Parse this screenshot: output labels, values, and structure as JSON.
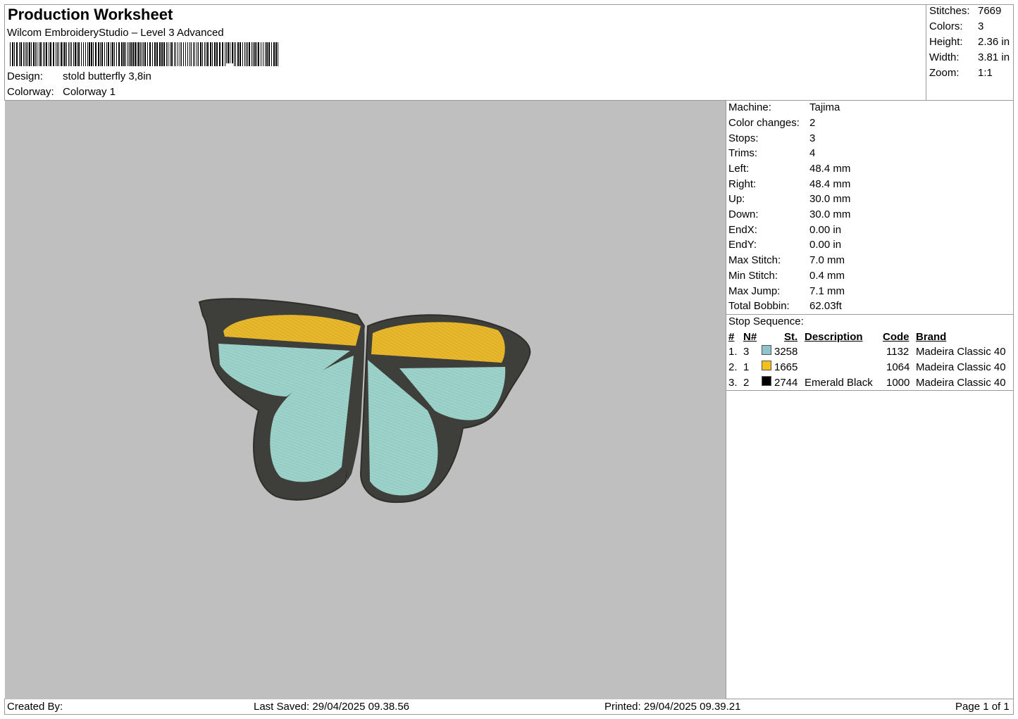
{
  "header": {
    "title": "Production Worksheet",
    "software": "Wilcom EmbroideryStudio – Level 3 Advanced",
    "design_label": "Design:",
    "design_value": "stold butterfly 3,8in",
    "colorway_label": "Colorway:",
    "colorway_value": "Colorway 1"
  },
  "summary": [
    {
      "label": "Stitches:",
      "value": "7669"
    },
    {
      "label": "Colors:",
      "value": "3"
    },
    {
      "label": "Height:",
      "value": "2.36 in"
    },
    {
      "label": "Width:",
      "value": "3.81 in"
    },
    {
      "label": "Zoom:",
      "value": "1:1"
    }
  ],
  "machine_info": [
    {
      "label": "Machine:",
      "value": "Tajima"
    },
    {
      "label": "Color changes:",
      "value": "2"
    },
    {
      "label": "Stops:",
      "value": "3"
    },
    {
      "label": "Trims:",
      "value": "4"
    },
    {
      "label": "Left:",
      "value": "48.4 mm"
    },
    {
      "label": "Right:",
      "value": "48.4 mm"
    },
    {
      "label": "Up:",
      "value": "30.0 mm"
    },
    {
      "label": "Down:",
      "value": "30.0 mm"
    },
    {
      "label": "EndX:",
      "value": "0.00 in"
    },
    {
      "label": "EndY:",
      "value": "0.00 in"
    },
    {
      "label": "Max Stitch:",
      "value": "7.0 mm"
    },
    {
      "label": "Min Stitch:",
      "value": "0.4 mm"
    },
    {
      "label": "Max Jump:",
      "value": "7.1 mm"
    },
    {
      "label": "Total Bobbin:",
      "value": "62.03ft"
    }
  ],
  "stop_sequence": {
    "label": "Stop Sequence:",
    "headers": {
      "num": "#",
      "n": "N#",
      "st": "St.",
      "desc": "Description",
      "code": "Code",
      "brand": "Brand"
    },
    "rows": [
      {
        "num": "1.",
        "n": "3",
        "color": "#8fc4cf",
        "st": "3258",
        "desc": "",
        "code": "1132",
        "brand": "Madeira Classic 40"
      },
      {
        "num": "2.",
        "n": "1",
        "color": "#f2c21b",
        "st": "1665",
        "desc": "",
        "code": "1064",
        "brand": "Madeira Classic 40"
      },
      {
        "num": "3.",
        "n": "2",
        "color": "#000000",
        "st": "2744",
        "desc": "Emerald Black",
        "code": "1000",
        "brand": "Madeira Classic 40"
      }
    ]
  },
  "footer": {
    "created_by": "Created By:",
    "last_saved": "Last Saved: 29/04/2025 09.38.56",
    "printed": "Printed: 29/04/2025 09.39.21",
    "page": "Page 1 of 1"
  },
  "design_colors": {
    "outline": "#3e3e3a",
    "yellow": "#e7b72c",
    "blue": "#9cd2ca",
    "background": "#bfbfbf"
  }
}
